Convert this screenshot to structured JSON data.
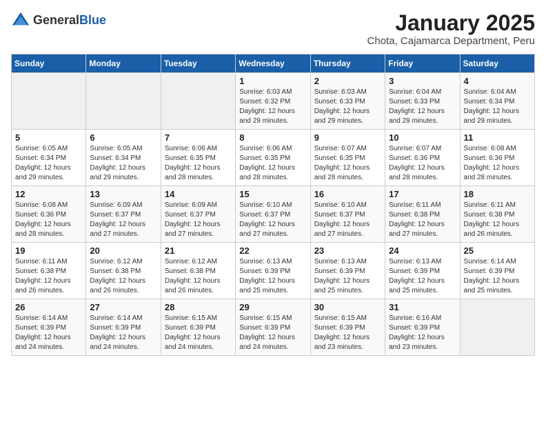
{
  "logo": {
    "general": "General",
    "blue": "Blue"
  },
  "header": {
    "month": "January 2025",
    "location": "Chota, Cajamarca Department, Peru"
  },
  "weekdays": [
    "Sunday",
    "Monday",
    "Tuesday",
    "Wednesday",
    "Thursday",
    "Friday",
    "Saturday"
  ],
  "weeks": [
    [
      {
        "day": "",
        "detail": ""
      },
      {
        "day": "",
        "detail": ""
      },
      {
        "day": "",
        "detail": ""
      },
      {
        "day": "1",
        "detail": "Sunrise: 6:03 AM\nSunset: 6:32 PM\nDaylight: 12 hours\nand 29 minutes."
      },
      {
        "day": "2",
        "detail": "Sunrise: 6:03 AM\nSunset: 6:33 PM\nDaylight: 12 hours\nand 29 minutes."
      },
      {
        "day": "3",
        "detail": "Sunrise: 6:04 AM\nSunset: 6:33 PM\nDaylight: 12 hours\nand 29 minutes."
      },
      {
        "day": "4",
        "detail": "Sunrise: 6:04 AM\nSunset: 6:34 PM\nDaylight: 12 hours\nand 29 minutes."
      }
    ],
    [
      {
        "day": "5",
        "detail": "Sunrise: 6:05 AM\nSunset: 6:34 PM\nDaylight: 12 hours\nand 29 minutes."
      },
      {
        "day": "6",
        "detail": "Sunrise: 6:05 AM\nSunset: 6:34 PM\nDaylight: 12 hours\nand 29 minutes."
      },
      {
        "day": "7",
        "detail": "Sunrise: 6:06 AM\nSunset: 6:35 PM\nDaylight: 12 hours\nand 28 minutes."
      },
      {
        "day": "8",
        "detail": "Sunrise: 6:06 AM\nSunset: 6:35 PM\nDaylight: 12 hours\nand 28 minutes."
      },
      {
        "day": "9",
        "detail": "Sunrise: 6:07 AM\nSunset: 6:35 PM\nDaylight: 12 hours\nand 28 minutes."
      },
      {
        "day": "10",
        "detail": "Sunrise: 6:07 AM\nSunset: 6:36 PM\nDaylight: 12 hours\nand 28 minutes."
      },
      {
        "day": "11",
        "detail": "Sunrise: 6:08 AM\nSunset: 6:36 PM\nDaylight: 12 hours\nand 28 minutes."
      }
    ],
    [
      {
        "day": "12",
        "detail": "Sunrise: 6:08 AM\nSunset: 6:36 PM\nDaylight: 12 hours\nand 28 minutes."
      },
      {
        "day": "13",
        "detail": "Sunrise: 6:09 AM\nSunset: 6:37 PM\nDaylight: 12 hours\nand 27 minutes."
      },
      {
        "day": "14",
        "detail": "Sunrise: 6:09 AM\nSunset: 6:37 PM\nDaylight: 12 hours\nand 27 minutes."
      },
      {
        "day": "15",
        "detail": "Sunrise: 6:10 AM\nSunset: 6:37 PM\nDaylight: 12 hours\nand 27 minutes."
      },
      {
        "day": "16",
        "detail": "Sunrise: 6:10 AM\nSunset: 6:37 PM\nDaylight: 12 hours\nand 27 minutes."
      },
      {
        "day": "17",
        "detail": "Sunrise: 6:11 AM\nSunset: 6:38 PM\nDaylight: 12 hours\nand 27 minutes."
      },
      {
        "day": "18",
        "detail": "Sunrise: 6:11 AM\nSunset: 6:38 PM\nDaylight: 12 hours\nand 26 minutes."
      }
    ],
    [
      {
        "day": "19",
        "detail": "Sunrise: 6:11 AM\nSunset: 6:38 PM\nDaylight: 12 hours\nand 26 minutes."
      },
      {
        "day": "20",
        "detail": "Sunrise: 6:12 AM\nSunset: 6:38 PM\nDaylight: 12 hours\nand 26 minutes."
      },
      {
        "day": "21",
        "detail": "Sunrise: 6:12 AM\nSunset: 6:38 PM\nDaylight: 12 hours\nand 26 minutes."
      },
      {
        "day": "22",
        "detail": "Sunrise: 6:13 AM\nSunset: 6:39 PM\nDaylight: 12 hours\nand 25 minutes."
      },
      {
        "day": "23",
        "detail": "Sunrise: 6:13 AM\nSunset: 6:39 PM\nDaylight: 12 hours\nand 25 minutes."
      },
      {
        "day": "24",
        "detail": "Sunrise: 6:13 AM\nSunset: 6:39 PM\nDaylight: 12 hours\nand 25 minutes."
      },
      {
        "day": "25",
        "detail": "Sunrise: 6:14 AM\nSunset: 6:39 PM\nDaylight: 12 hours\nand 25 minutes."
      }
    ],
    [
      {
        "day": "26",
        "detail": "Sunrise: 6:14 AM\nSunset: 6:39 PM\nDaylight: 12 hours\nand 24 minutes."
      },
      {
        "day": "27",
        "detail": "Sunrise: 6:14 AM\nSunset: 6:39 PM\nDaylight: 12 hours\nand 24 minutes."
      },
      {
        "day": "28",
        "detail": "Sunrise: 6:15 AM\nSunset: 6:39 PM\nDaylight: 12 hours\nand 24 minutes."
      },
      {
        "day": "29",
        "detail": "Sunrise: 6:15 AM\nSunset: 6:39 PM\nDaylight: 12 hours\nand 24 minutes."
      },
      {
        "day": "30",
        "detail": "Sunrise: 6:15 AM\nSunset: 6:39 PM\nDaylight: 12 hours\nand 23 minutes."
      },
      {
        "day": "31",
        "detail": "Sunrise: 6:16 AM\nSunset: 6:39 PM\nDaylight: 12 hours\nand 23 minutes."
      },
      {
        "day": "",
        "detail": ""
      }
    ]
  ]
}
